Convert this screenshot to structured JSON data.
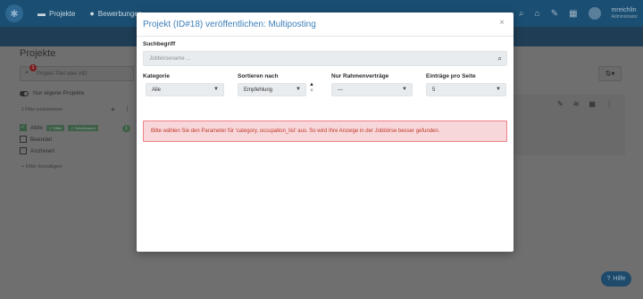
{
  "topbar": {
    "nav": [
      {
        "label": "Projekte",
        "icon": "folder-icon"
      },
      {
        "label": "Bewerbungen",
        "icon": "users-icon"
      }
    ],
    "user": {
      "name": "mreichlin",
      "role": "Administrator"
    }
  },
  "background": {
    "page_title": "Projekte",
    "search_placeholder": "Projekt-Titel oder #ID",
    "search_badge": "1",
    "own_projects_label": "Nur eigene Projekte",
    "filter_reset": "1 Filter zurücksetzen",
    "status_items": [
      {
        "label": "Aktiv",
        "checked": true,
        "tags": [
          "Offen",
          "Geschlossen"
        ],
        "count": "1"
      },
      {
        "label": "Beendet",
        "checked": false
      },
      {
        "label": "Archiviert",
        "checked": false
      }
    ],
    "add_filter": "Filter hinzufügen",
    "help_label": "Hilfe"
  },
  "modal": {
    "title": "Projekt (ID#18) veröffentlichen: Multiposting",
    "search": {
      "label": "Suchbegriff",
      "placeholder": "Jobbörsename ..."
    },
    "filters": {
      "category": {
        "label": "Kategorie",
        "value": "Alle"
      },
      "sort": {
        "label": "Sortieren nach",
        "value": "Empfehlung"
      },
      "frame": {
        "label": "Nur Rahmenverträge",
        "value": "---"
      },
      "per_page": {
        "label": "Einträge pro Seite",
        "value": "5"
      }
    },
    "alert": "Bitte wählen Sie den Parameter für 'category, occupation_list' aus. So wird Ihre Anzeige in der Jobbörse besser gefunden.",
    "colors": {
      "title": "#3d7fb8",
      "alert_bg": "#f8d7da",
      "alert_text": "#c0392b"
    }
  }
}
